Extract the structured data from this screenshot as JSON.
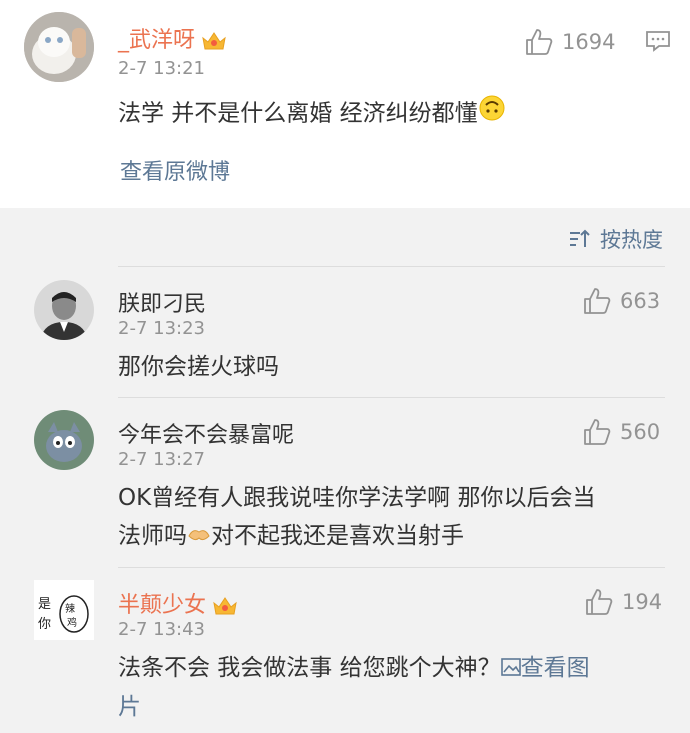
{
  "main_post": {
    "username": "_武洋呀",
    "time": "2-7 13:21",
    "likes": "1694",
    "text": "法学 并不是什么离婚 经济纠纷都懂",
    "view_original": "查看原微博"
  },
  "sort": {
    "label": "按热度"
  },
  "comments": [
    {
      "username": "朕即刁民",
      "time": "2-7 13:23",
      "likes": "663",
      "text": "那你会搓火球吗"
    },
    {
      "username": "今年会不会暴富呢",
      "time": "2-7 13:27",
      "likes": "560",
      "text_line1": "OK曾经有人跟我说哇你学法学啊 那你以后会当",
      "text_line2a": "法师吗",
      "text_line2b": "对不起我还是喜欢当射手"
    },
    {
      "username": "半颠少女",
      "time": "2-7 13:43",
      "likes": "194",
      "text_line1": "法条不会 我会做法事 给您跳个大神？",
      "view_image": "查看图",
      "text_line2": "片",
      "avatar_text": [
        "是你",
        "辣鸡"
      ]
    }
  ],
  "colors": {
    "vip_name": "#eb7350",
    "link": "#5d7895",
    "meta": "#939393"
  }
}
